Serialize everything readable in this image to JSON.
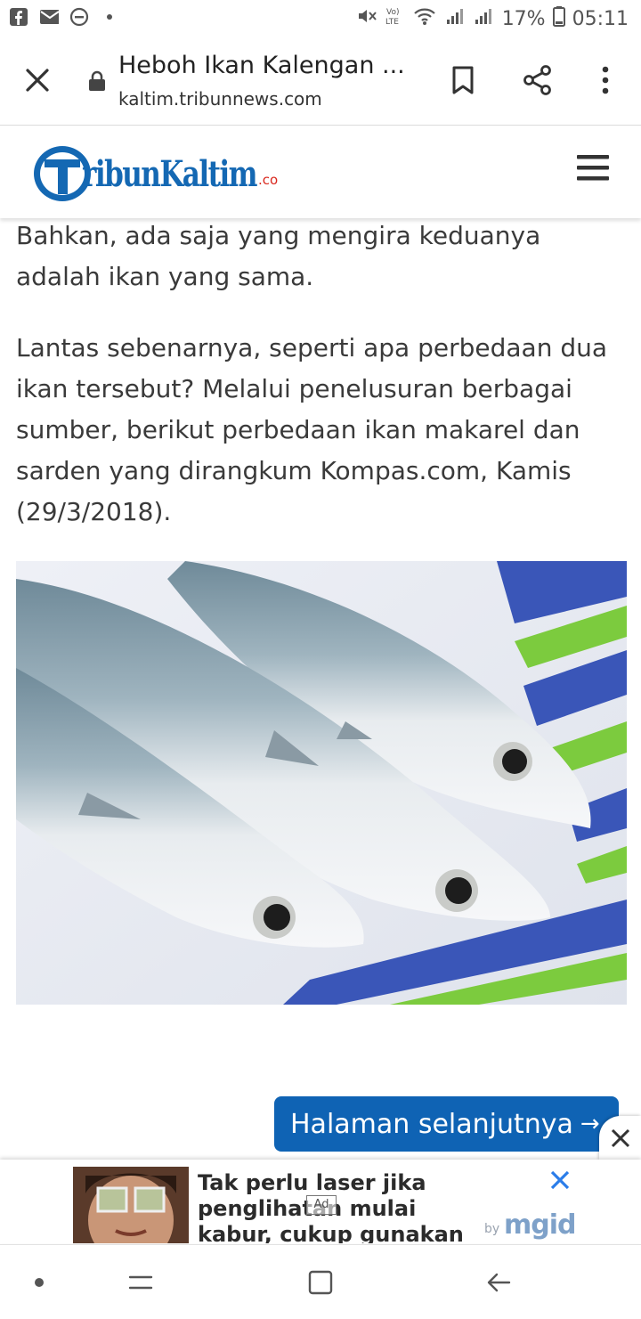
{
  "status_bar": {
    "battery": "17%",
    "time": "05:11",
    "left_icons": [
      "facebook-icon",
      "mail-icon",
      "do-not-disturb-icon",
      "dot-icon"
    ],
    "right_icons": [
      "mute-icon",
      "volte-icon",
      "wifi-icon",
      "signal-icon",
      "signal-icon",
      "battery-icon"
    ]
  },
  "toolbar": {
    "title": "Heboh Ikan Kalengan ...",
    "url": "kaltim.tribunnews.com"
  },
  "site": {
    "logo_text_main": "TribunKaltim",
    "logo_suffix": ".co",
    "colors": {
      "brand_blue": "#1468b3",
      "brand_red": "#d9261c"
    }
  },
  "article": {
    "paragraph1": "Bahkan, ada saja yang mengira keduanya adalah ikan yang sama.",
    "paragraph2": "Lantas sebenarnya, seperti apa perbedaan dua ikan tersebut? Melalui penelusuran berbagai sumber, berikut perbedaan ikan makarel dan sarden yang dirangkum Kompas.com, Kamis (29/3/2018)."
  },
  "next_button": {
    "label": "Halaman selanjutnya",
    "arrow": "→",
    "color": "#0f63b4"
  },
  "ad": {
    "text": "Tak perlu laser jika penglihatan mulai kabur, cukup gunakan ini!",
    "label": "Ad",
    "by": "by",
    "brand": "mgid"
  }
}
